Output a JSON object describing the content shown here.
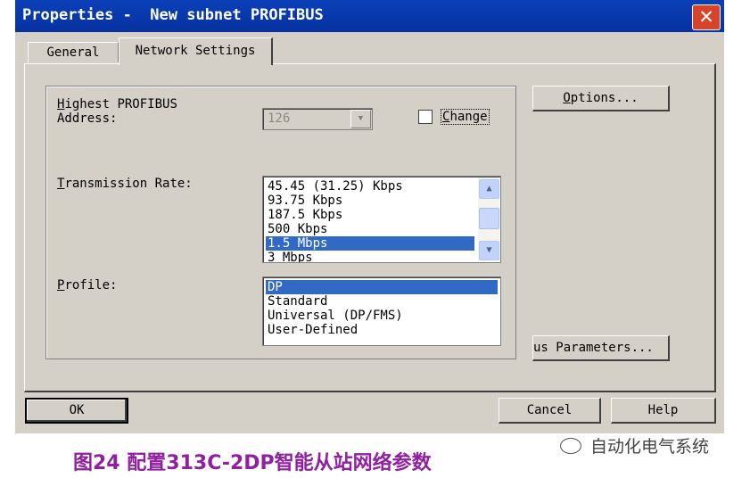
{
  "window": {
    "title": "Properties -  New subnet PROFIBUS",
    "close_glyph": "✕"
  },
  "tabs": [
    {
      "label": "General",
      "active": false
    },
    {
      "label": "Network Settings",
      "active": true
    }
  ],
  "address": {
    "label_line1_prefix": "H",
    "label_line1_rest": "ighest PROFIBUS",
    "label_line2": "Address:",
    "value": "126",
    "change_checkbox_checked": false,
    "change_mnemonic": "C",
    "change_rest": "hange"
  },
  "transmission_rate": {
    "label_prefix": "T",
    "label_rest": "ransmission Rate:",
    "options": [
      "45.45 (31.25) Kbps",
      "93.75 Kbps",
      "187.5 Kbps",
      "500 Kbps",
      "1.5 Mbps",
      "3 Mbps"
    ],
    "selected": "1.5 Mbps"
  },
  "profile": {
    "label_prefix": "P",
    "label_rest": "rofile:",
    "options": [
      "DP",
      "Standard",
      "Universal (DP/FMS)",
      "User-Defined"
    ],
    "selected": "DP"
  },
  "buttons": {
    "options_prefix": "O",
    "options_rest": "ptions...",
    "bus_parameters": "us Parameters...",
    "ok": "OK",
    "cancel": "Cancel",
    "help": "Help"
  },
  "caption": "图24 配置313C-2DP智能从站网络参数",
  "watermark": "自动化电气系统",
  "colors": {
    "titlebar": "#0a3fb8",
    "dialog": "#d4d0c8",
    "selection": "#316ac5",
    "caption": "#9020a0"
  }
}
